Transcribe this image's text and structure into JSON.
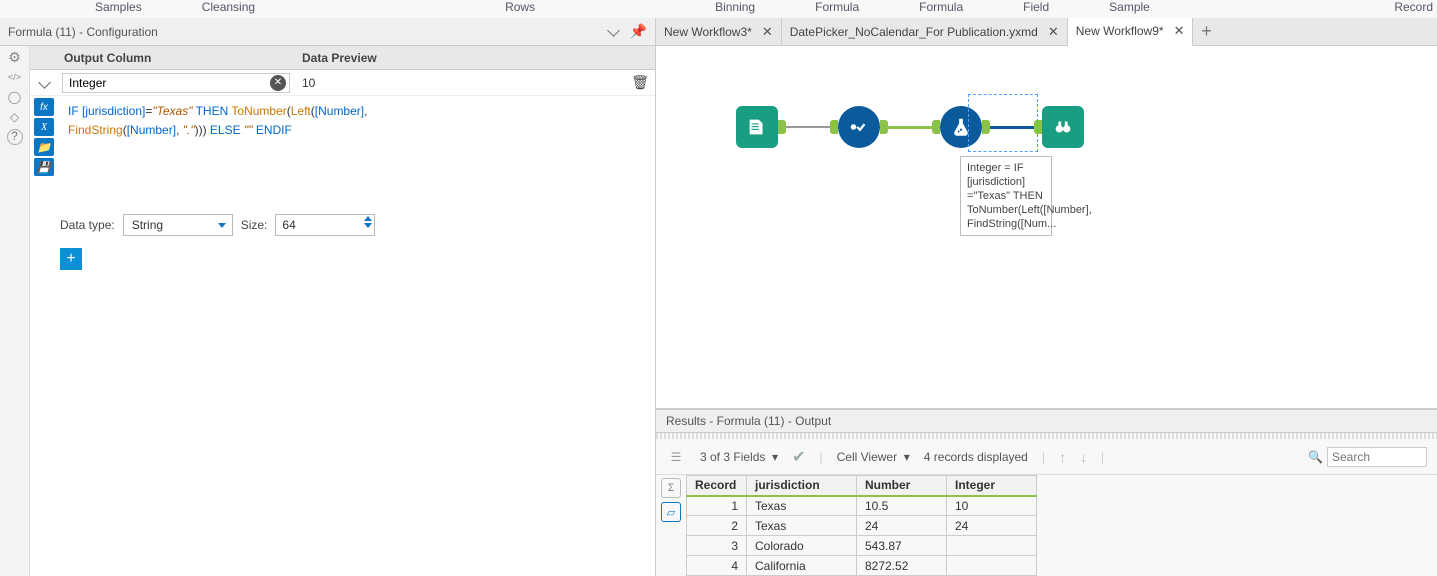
{
  "topMenu": [
    "Samples",
    "Cleansing",
    "Rows",
    "Binning",
    "Formula",
    "Formula",
    "Field",
    "Sample",
    "Record"
  ],
  "config": {
    "title": "Formula (11) - Configuration",
    "outputColHeader": "Output Column",
    "dataPreviewHeader": "Data Preview",
    "columnName": "Integer",
    "previewValue": "10",
    "dataTypeLabel": "Data type:",
    "dataTypeValue": "String",
    "sizeLabel": "Size:",
    "sizeValue": "64"
  },
  "formula": {
    "tokens": [
      {
        "t": "kw",
        "v": "IF "
      },
      {
        "t": "fld",
        "v": "[jurisdiction]"
      },
      {
        "t": "plain",
        "v": "="
      },
      {
        "t": "str",
        "v": "\"Texas\""
      },
      {
        "t": "kw",
        "v": " THEN "
      },
      {
        "t": "fn",
        "v": "ToNumber"
      },
      {
        "t": "plain",
        "v": "("
      },
      {
        "t": "fn",
        "v": "Left"
      },
      {
        "t": "plain",
        "v": "("
      },
      {
        "t": "fld",
        "v": "[Number]"
      },
      {
        "t": "plain",
        "v": ", "
      },
      {
        "t": "br",
        "v": ""
      },
      {
        "t": "fn",
        "v": "FindString"
      },
      {
        "t": "plain",
        "v": "("
      },
      {
        "t": "fld",
        "v": "[Number]"
      },
      {
        "t": "plain",
        "v": ", "
      },
      {
        "t": "str",
        "v": "\".\""
      },
      {
        "t": "plain",
        "v": "))) "
      },
      {
        "t": "kw",
        "v": "ELSE "
      },
      {
        "t": "str",
        "v": "\"\""
      },
      {
        "t": "kw",
        "v": " ENDIF"
      }
    ]
  },
  "tabs": [
    {
      "label": "New Workflow3*",
      "active": false
    },
    {
      "label": "DatePicker_NoCalendar_For Publication.yxmd",
      "active": false
    },
    {
      "label": "New Workflow9*",
      "active": true
    }
  ],
  "annotation": "Integer = IF [jurisdiction] =\"Texas\" THEN ToNumber(Left([Number], FindString([Num...",
  "results": {
    "title": "Results - Formula (11) - Output",
    "fieldsText": "3 of 3 Fields",
    "cellViewer": "Cell Viewer",
    "recordsText": "4 records displayed",
    "searchPlaceholder": "Search",
    "headers": [
      "Record",
      "jurisdiction",
      "Number",
      "Integer"
    ],
    "rows": [
      {
        "rec": "1",
        "jurisdiction": "Texas",
        "Number": "10.5",
        "Integer": "10"
      },
      {
        "rec": "2",
        "jurisdiction": "Texas",
        "Number": "24",
        "Integer": "24"
      },
      {
        "rec": "3",
        "jurisdiction": "Colorado",
        "Number": "543.87",
        "Integer": ""
      },
      {
        "rec": "4",
        "jurisdiction": "California",
        "Number": "8272.52",
        "Integer": ""
      }
    ]
  }
}
